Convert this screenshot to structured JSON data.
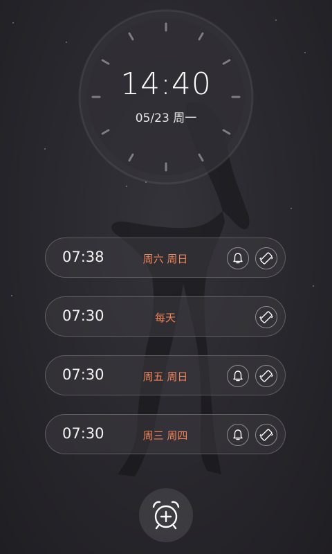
{
  "clock": {
    "time": "14:40",
    "date": "05/23 周一"
  },
  "alarms": [
    {
      "time": "07:38",
      "days": "周六 周日",
      "bell": true,
      "vibrate": true
    },
    {
      "time": "07:30",
      "days": "每天",
      "bell": false,
      "vibrate": true
    },
    {
      "time": "07:30",
      "days": "周五 周日",
      "bell": true,
      "vibrate": true
    },
    {
      "time": "07:30",
      "days": "周三 周四",
      "bell": true,
      "vibrate": true
    }
  ],
  "icons": {
    "bell": "bell-icon",
    "vibrate": "vibrate-icon",
    "add_alarm": "add-alarm-clock-icon"
  },
  "colors": {
    "days_text": "#f0845a",
    "background": "#2a292f"
  }
}
